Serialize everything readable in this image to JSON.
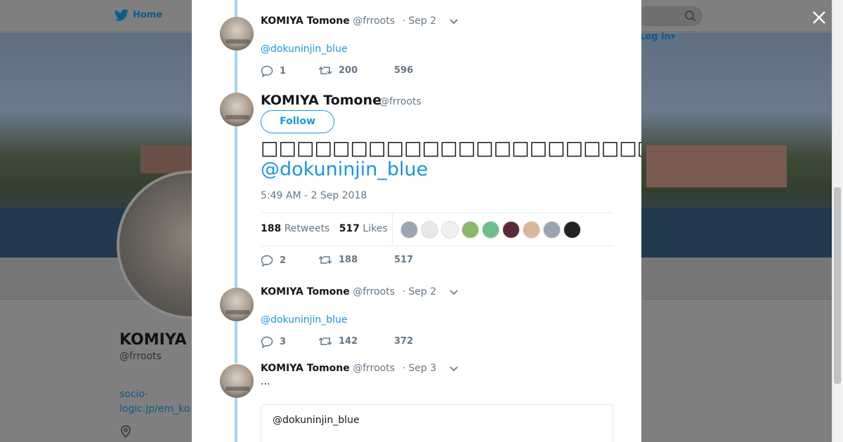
{
  "background": {
    "nav_home": "Home",
    "login": "Log in",
    "profile_name": "KOMIYA T",
    "profile_handle": "@frroots",
    "profile_link": "socio-logic.jp/em_ko"
  },
  "tweets": [
    {
      "name": "KOMIYA Tomone",
      "handle": "@frroots",
      "date": "· Sep 2",
      "mention": "@dokuninjin_blue",
      "replies": "1",
      "retweets": "200",
      "likes": "596"
    },
    {
      "name": "KOMIYA Tomone",
      "handle": "@frroots",
      "date": "· Sep 2",
      "mention": "@dokuninjin_blue",
      "replies": "3",
      "retweets": "142",
      "likes": "372"
    },
    {
      "name": "KOMIYA Tomone",
      "handle": "@frroots",
      "date": "· Sep 3",
      "text": "...",
      "quote": "@dokuninjin_blue"
    }
  ],
  "focused": {
    "name": "KOMIYA Tomone",
    "handle": "@frroots",
    "follow_label": "Follow",
    "text": "□□□□□□□□□□□□□□□□□□□□□□□□□□□□□□□□□□□□□□□",
    "mention": "@dokuninjin_blue",
    "timestamp": "5:49 AM - 2 Sep 2018",
    "retweet_count": "188",
    "retweet_label": "Retweets",
    "like_count": "517",
    "like_label": "Likes",
    "replies": "2",
    "retweets": "188",
    "likes": "517",
    "liker_colors": [
      "#9aa5b1",
      "#e8e8e8",
      "#f0f0f0",
      "#8ab86a",
      "#6dbf8a",
      "#5a2a3a",
      "#d9b89a",
      "#9aa5b1",
      "#222222"
    ]
  }
}
